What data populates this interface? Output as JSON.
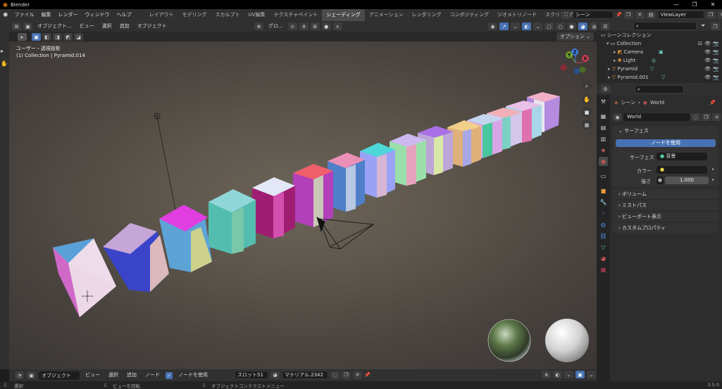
{
  "titlebar": {
    "app_title": "Blender"
  },
  "menu": {
    "items": [
      "ファイル",
      "編集",
      "レンダー",
      "ウィンドウ",
      "ヘルプ"
    ]
  },
  "workspaces": [
    "レイアウト",
    "モデリング",
    "スカルプト",
    "UV編集",
    "テクスチャペイント",
    "シェーディング",
    "アニメーション",
    "レンダリング",
    "コンポジティング",
    "ジオメトリノード",
    "スクリプト作成"
  ],
  "workspace_add": "+",
  "scene": {
    "name": "シーン",
    "viewlayer": "ViewLayer"
  },
  "viewport_header": {
    "mode": "オブジェクト...",
    "menus": [
      "ビュー",
      "選択",
      "追加",
      "オブジェクト"
    ],
    "transform": "グロ...",
    "options": "オプション"
  },
  "viewport": {
    "view_name": "ユーザー・透視投影",
    "object_info": "(1) Collection | Pyramid.014",
    "gizmo": {
      "x": "X",
      "y": "Y",
      "z": "Z"
    }
  },
  "bottom_header": {
    "mode": "オブジェクト",
    "menus": [
      "ビュー",
      "選択",
      "追加",
      "ノード"
    ],
    "use_nodes": "ノードを使用",
    "slot": "スロット51",
    "material": "マテリアル.2342"
  },
  "statusbar": {
    "select": "選択",
    "rotate": "ビューを回転",
    "context": "オブジェクトコンテクストメニュー",
    "version": "3.5.0"
  },
  "outliner": {
    "root": "シーンコレクション",
    "rows": [
      "Collection",
      "Camera",
      "Light",
      "Pyramid",
      "Pyramid.001"
    ]
  },
  "properties": {
    "breadcrumb_scene": "シーン",
    "breadcrumb_world": "World",
    "world_name": "World",
    "surface_panel": "サーフェス",
    "use_nodes_button": "ノードを使用",
    "surface_label": "サーフェス",
    "surface_value": "背景",
    "color_label": "カラー",
    "strength_label": "強さ",
    "strength_value": "1.000",
    "panels": [
      "ボリューム",
      "ミストパス",
      "ビューポート表示",
      "カスタムプロパティ"
    ]
  },
  "colors": {
    "accent": "#4772b3",
    "header": "#303030",
    "panel": "#2d2d2d"
  }
}
